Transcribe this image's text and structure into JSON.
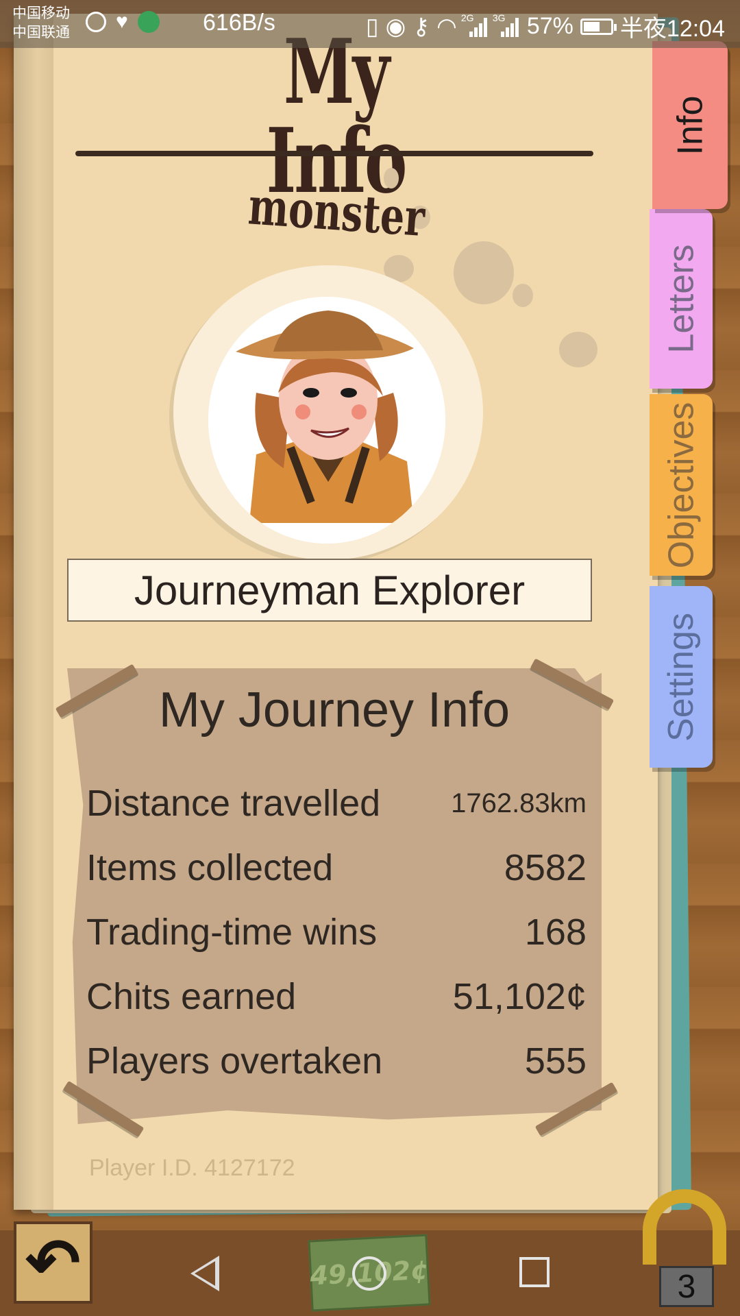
{
  "status_bar": {
    "carrier_1": "中国移动",
    "carrier_2": "中国联通",
    "net_speed": "616B/s",
    "signal_1_label": "2G",
    "signal_2_label": "3G",
    "battery": "57%",
    "time": "半夜12:04"
  },
  "header": {
    "title": "My Info",
    "username": "monster"
  },
  "tabs": [
    {
      "label": "Info",
      "color": "#f58c84"
    },
    {
      "label": "Letters",
      "color": "#f3a9ef"
    },
    {
      "label": "Objectives",
      "color": "#f7b14a"
    },
    {
      "label": "Settings",
      "color": "#9fb5f8"
    }
  ],
  "profile": {
    "rank": "Journeyman Explorer"
  },
  "journey": {
    "title": "My Journey Info",
    "stats": [
      {
        "label": "Distance travelled",
        "value": "1762.83km"
      },
      {
        "label": "Items collected",
        "value": "8582"
      },
      {
        "label": "Trading-time wins",
        "value": "168"
      },
      {
        "label": "Chits earned",
        "value": "51,102¢"
      },
      {
        "label": "Players overtaken",
        "value": "555"
      }
    ]
  },
  "player_id": "Player I.D. 4127172",
  "bottom": {
    "money": "49,102¢",
    "horseshoe_count": "3"
  }
}
